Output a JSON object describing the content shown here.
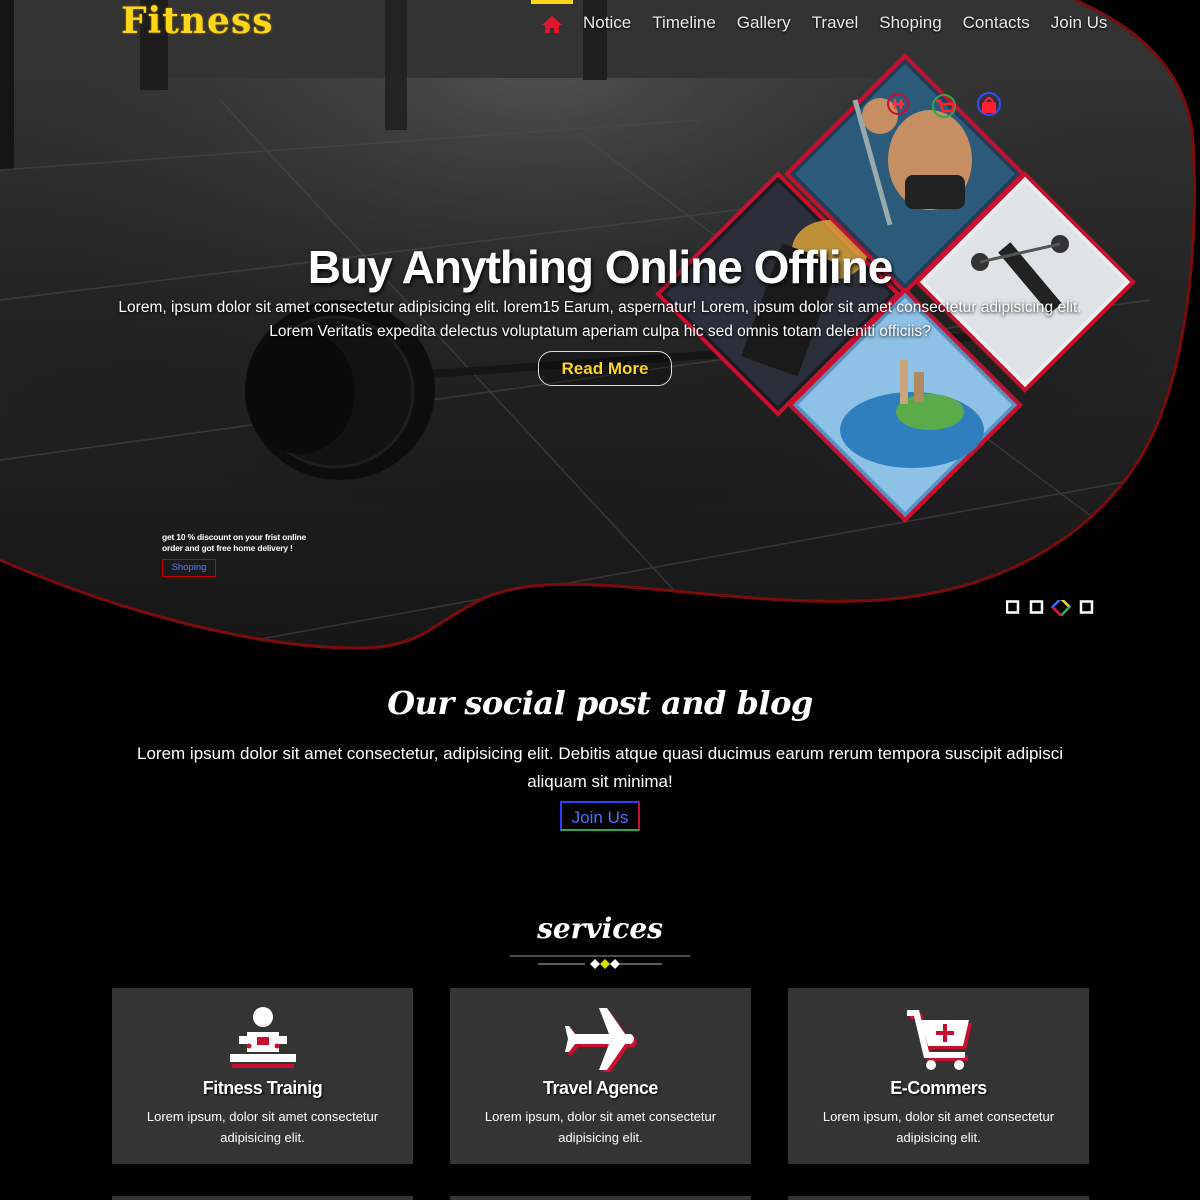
{
  "brand": {
    "logo": "Fitness",
    "accent": "#ffd51a",
    "brand_red": "#c8102e"
  },
  "nav": {
    "home_icon": "home-icon",
    "links": [
      "Notice",
      "Timeline",
      "Gallery",
      "Travel",
      "Shoping",
      "Contacts",
      "Join Us"
    ]
  },
  "hero": {
    "title": "Buy Anything Online Offline",
    "text": "Lorem, ipsum dolor sit amet consectetur adipisicing elit. lorem15 Earum, aspernatur! Lorem, ipsum dolor sit amet consectetur adipisicing elit. Lorem Veritatis expedita delectus voluptatum aperiam culpa hic sed omnis totam deleniti officiis?",
    "read_more": "Read More",
    "promo": "get 10 % discount on your frist online order and got free home delivery !",
    "shop_button": "Shoping",
    "collage_icons": [
      "dumbbell-icon",
      "cart-icon",
      "bag-icon"
    ],
    "slider_active_index": 2,
    "slider_count": 4
  },
  "blog": {
    "title": "Our social post and blog",
    "text": "Lorem ipsum dolor sit amet consectetur, adipisicing elit. Debitis atque quasi ducimus earum rerum tempora suscipit adipisci aliquam sit minima!",
    "join_button": "Join Us"
  },
  "services": {
    "title": "services",
    "items": [
      {
        "title": "Fitness Trainig",
        "text": "Lorem ipsum, dolor sit amet consectetur adipisicing elit.",
        "icon": "trainer-icon"
      },
      {
        "title": "Travel Agence",
        "text": "Lorem ipsum, dolor sit amet consectetur adipisicing elit.",
        "icon": "plane-icon"
      },
      {
        "title": "E-Commers",
        "text": "Lorem ipsum, dolor sit amet consectetur adipisicing elit.",
        "icon": "cart-plus-icon"
      }
    ]
  }
}
